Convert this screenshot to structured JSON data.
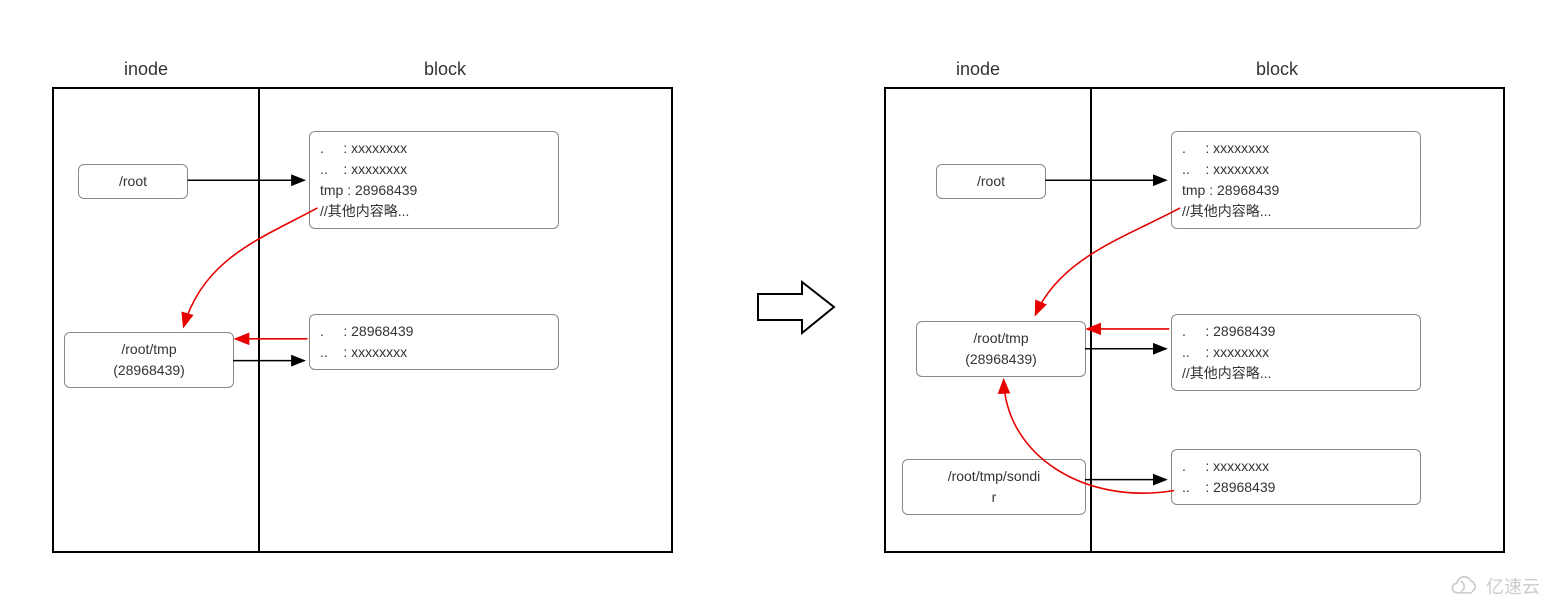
{
  "headers": {
    "inode": "inode",
    "block": "block"
  },
  "left": {
    "root_label": "/root",
    "root_block": ".     : xxxxxxxx\n..    : xxxxxxxx\ntmp : 28968439\n//其他内容略...",
    "tmp_label": "/root/tmp\n(28968439)",
    "tmp_block": ".     : 28968439\n..    : xxxxxxxx"
  },
  "right": {
    "root_label": "/root",
    "root_block": ".     : xxxxxxxx\n..    : xxxxxxxx\ntmp : 28968439\n//其他内容略...",
    "tmp_label": "/root/tmp\n(28968439)",
    "tmp_block": ".     : 28968439\n..    : xxxxxxxx\n//其他内容略...",
    "sondir_label": "/root/tmp/sondi\nr",
    "sondir_block": ".     : xxxxxxxx\n..    : 28968439"
  },
  "watermark": "亿速云",
  "chart_data": {
    "type": "diagram",
    "description": "Filesystem inode to block pointer illustration. Left state: /root directory block lists tmp->28968439; /root/tmp inode points to its block whose '.' is 28968439. Right state adds subdirectory /root/tmp/sondir whose '..' entry is 28968439 (parent). Red curved arrows highlight back-references to inode 28968439.",
    "left_state": {
      "inodes": [
        {
          "path": "/root"
        },
        {
          "path": "/root/tmp",
          "inode": 28968439
        }
      ],
      "blocks": [
        {
          "owner": "/root",
          "entries": {
            ".": "xxxxxxxx",
            "..": "xxxxxxxx",
            "tmp": 28968439
          }
        },
        {
          "owner": "/root/tmp",
          "entries": {
            ".": 28968439,
            "..": "xxxxxxxx"
          }
        }
      ],
      "red_arrows": [
        {
          "from_block": "/root",
          "from_entry": "tmp",
          "to_inode": "/root/tmp"
        },
        {
          "from_block": "/root/tmp",
          "from_entry": ".",
          "to_inode": "/root/tmp"
        }
      ]
    },
    "right_state": {
      "inodes": [
        {
          "path": "/root"
        },
        {
          "path": "/root/tmp",
          "inode": 28968439
        },
        {
          "path": "/root/tmp/sondir"
        }
      ],
      "blocks": [
        {
          "owner": "/root",
          "entries": {
            ".": "xxxxxxxx",
            "..": "xxxxxxxx",
            "tmp": 28968439
          }
        },
        {
          "owner": "/root/tmp",
          "entries": {
            ".": 28968439,
            "..": "xxxxxxxx"
          }
        },
        {
          "owner": "/root/tmp/sondir",
          "entries": {
            ".": "xxxxxxxx",
            "..": 28968439
          }
        }
      ],
      "red_arrows": [
        {
          "from_block": "/root",
          "from_entry": "tmp",
          "to_inode": "/root/tmp"
        },
        {
          "from_block": "/root/tmp",
          "from_entry": ".",
          "to_inode": "/root/tmp"
        },
        {
          "from_block": "/root/tmp/sondir",
          "from_entry": "..",
          "to_inode": "/root/tmp"
        }
      ]
    }
  }
}
